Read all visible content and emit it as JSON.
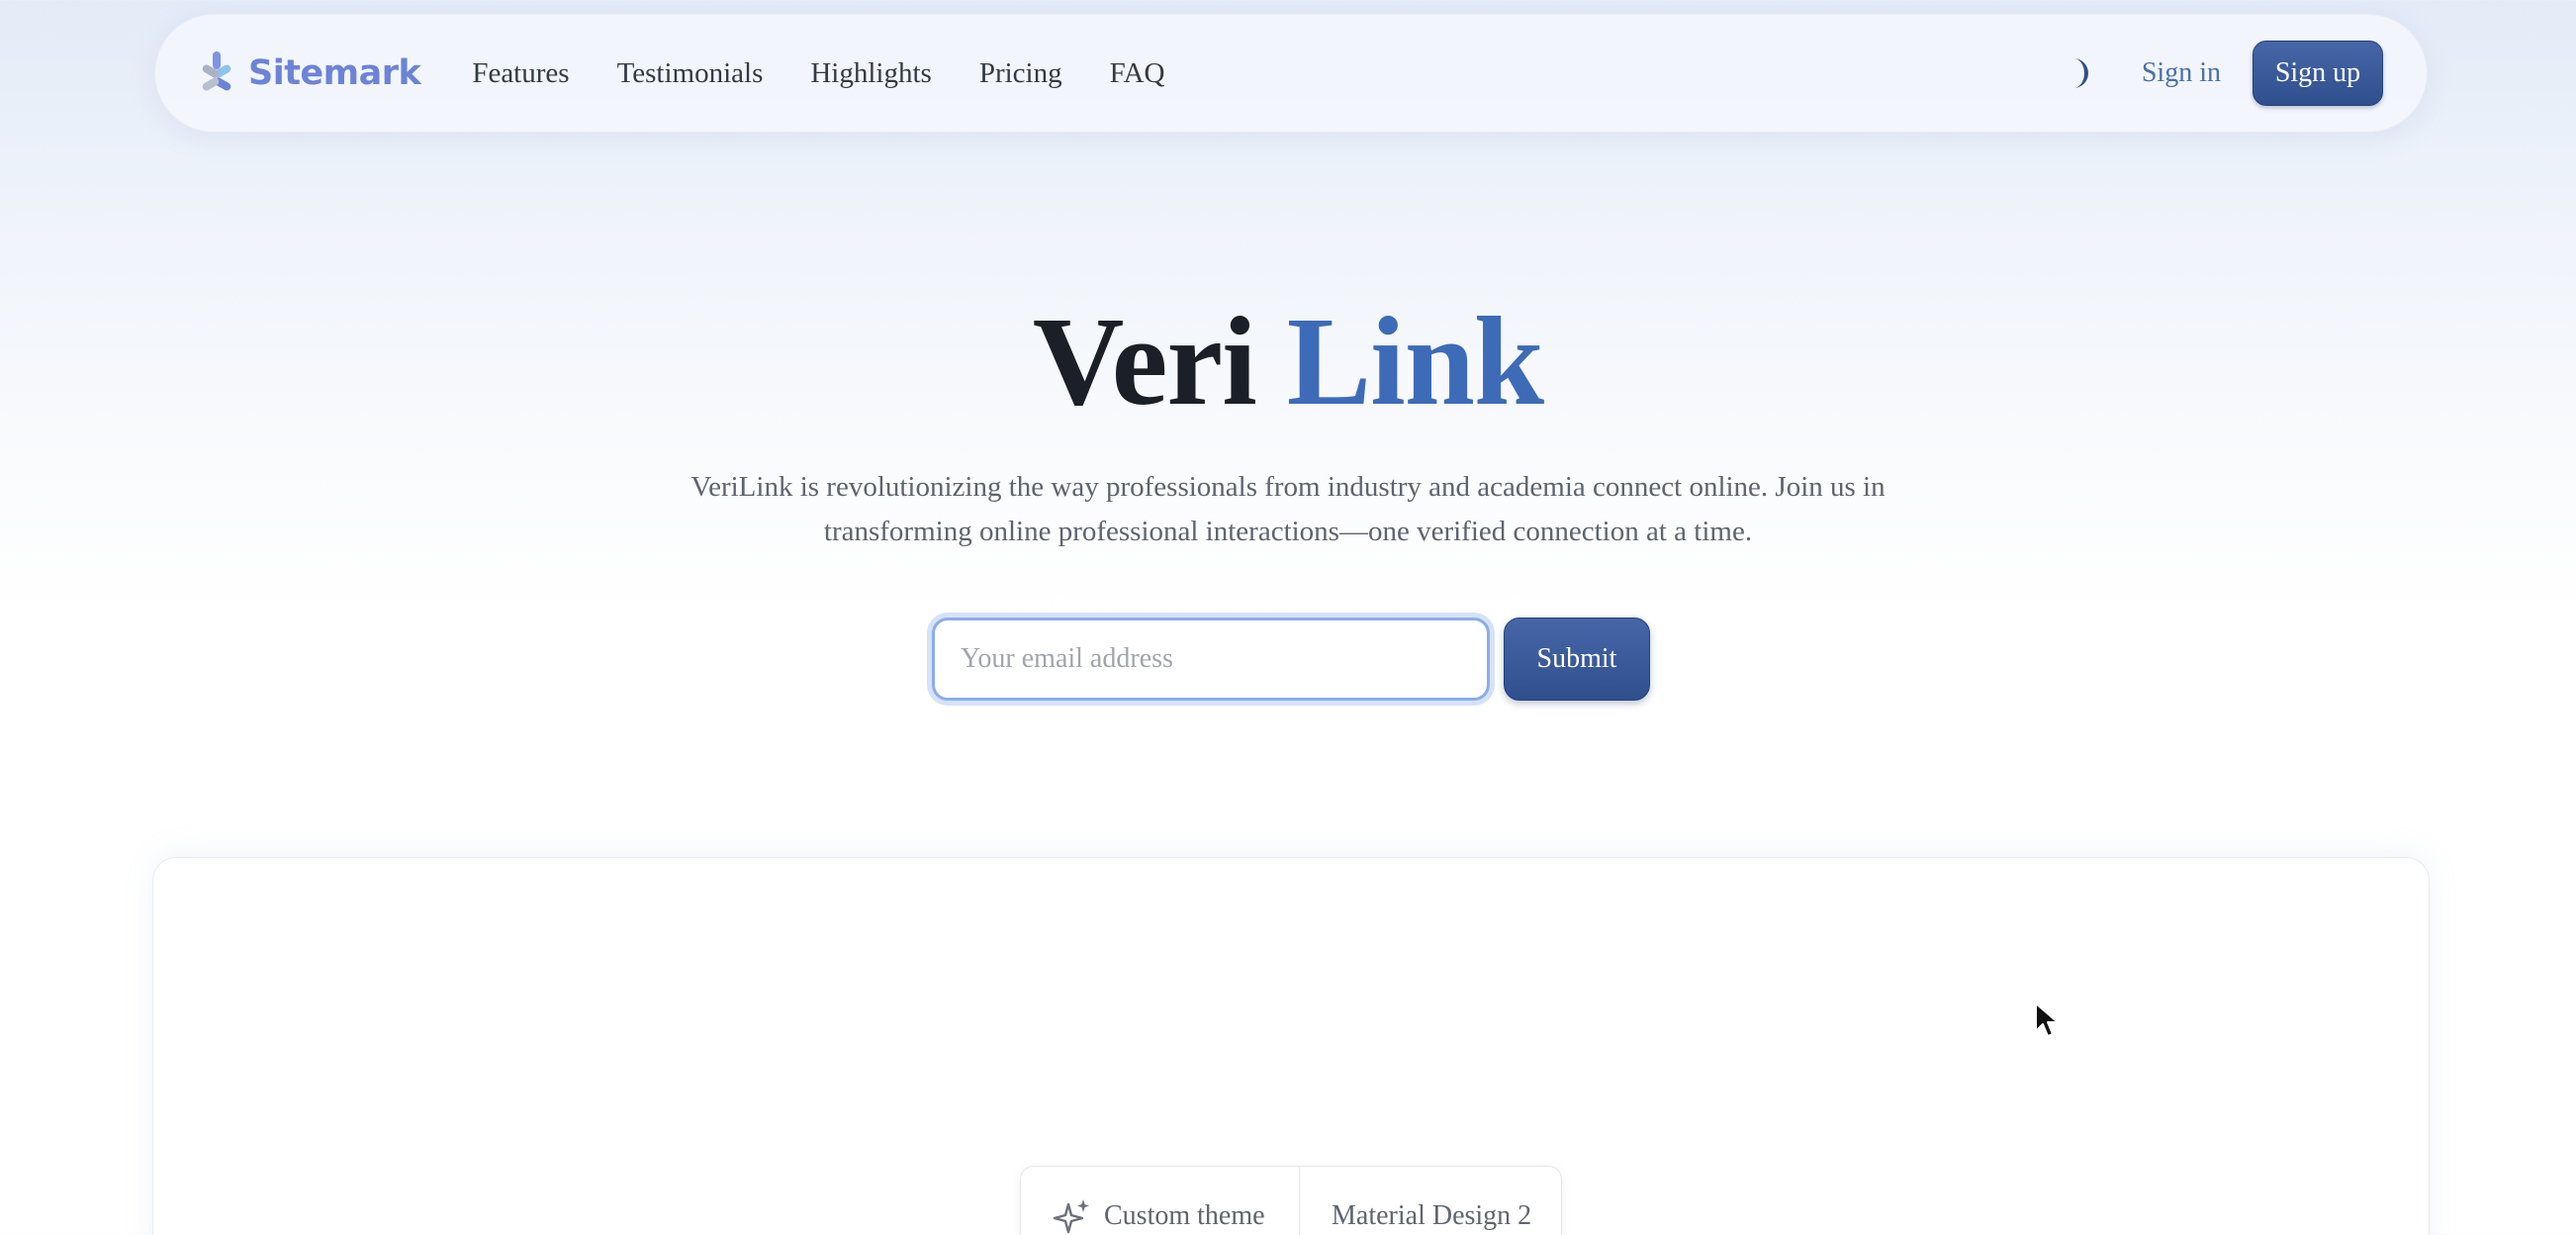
{
  "navbar": {
    "brand_name": "Sitemark",
    "links": [
      {
        "label": "Features"
      },
      {
        "label": "Testimonials"
      },
      {
        "label": "Highlights"
      },
      {
        "label": "Pricing"
      },
      {
        "label": "FAQ"
      }
    ],
    "theme_icon": "moon-icon",
    "signin_label": "Sign in",
    "signup_label": "Sign up"
  },
  "hero": {
    "title_part1": "Veri",
    "title_part2": "Link",
    "subtitle_line1": "VeriLink is revolutionizing the way professionals from industry and academia connect online. Join us in",
    "subtitle_line2": "transforming online professional interactions—one verified connection at a time.",
    "email_placeholder": "Your email address",
    "submit_label": "Submit"
  },
  "theme_switch": {
    "options": [
      {
        "label": "Custom theme",
        "icon": "sparkle-icon"
      },
      {
        "label": "Material Design 2"
      }
    ]
  },
  "colors": {
    "brand": "#6d83d6",
    "accent": "#3d6bb7",
    "button": "#2f4f8d"
  }
}
